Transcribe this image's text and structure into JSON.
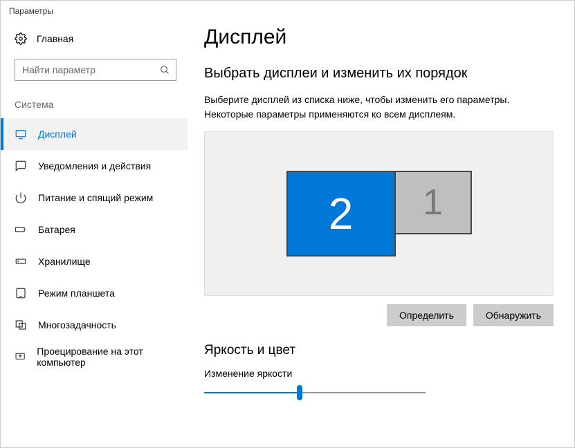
{
  "window": {
    "title": "Параметры"
  },
  "sidebar": {
    "home": "Главная",
    "searchPlaceholder": "Найти параметр",
    "sectionLabel": "Система",
    "items": [
      {
        "label": "Дисплей",
        "active": true,
        "icon": "display"
      },
      {
        "label": "Уведомления и действия",
        "active": false,
        "icon": "notifications"
      },
      {
        "label": "Питание и спящий режим",
        "active": false,
        "icon": "power"
      },
      {
        "label": "Батарея",
        "active": false,
        "icon": "battery"
      },
      {
        "label": "Хранилище",
        "active": false,
        "icon": "storage"
      },
      {
        "label": "Режим планшета",
        "active": false,
        "icon": "tablet"
      },
      {
        "label": "Многозадачность",
        "active": false,
        "icon": "multitask"
      },
      {
        "label": "Проецирование на этот компьютер",
        "active": false,
        "icon": "project"
      }
    ]
  },
  "main": {
    "pageTitle": "Дисплей",
    "arrangeTitle": "Выбрать дисплеи и изменить их порядок",
    "arrangeDesc": "Выберите дисплей из списка ниже, чтобы изменить его параметры. Некоторые параметры применяются ко всем дисплеям.",
    "monitors": {
      "selected": "2",
      "other": "1"
    },
    "buttons": {
      "identify": "Определить",
      "detect": "Обнаружить"
    },
    "brightnessSection": "Яркость и цвет",
    "brightnessLabel": "Изменение яркости",
    "brightnessPercent": 43
  }
}
